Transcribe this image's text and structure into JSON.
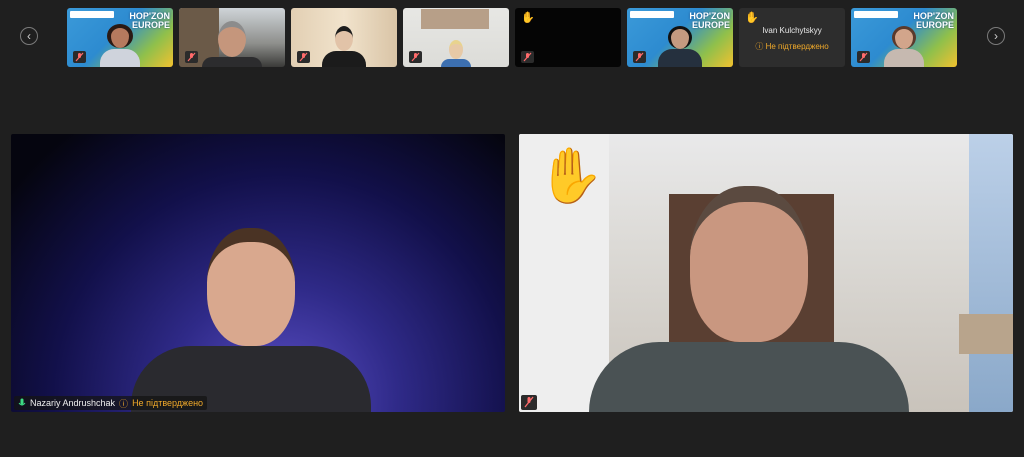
{
  "nav": {
    "prev_icon": "chevron-left-icon",
    "next_icon": "chevron-right-icon",
    "prev_glyph": "‹",
    "next_glyph": "›"
  },
  "thumbnails": [
    {
      "type": "banner",
      "banner_text": "HOP'ZON\nEUROPE",
      "muted": true
    },
    {
      "type": "video",
      "muted": true
    },
    {
      "type": "video",
      "muted": true
    },
    {
      "type": "video",
      "muted": true
    },
    {
      "type": "off",
      "hand_raised": true,
      "muted": true
    },
    {
      "type": "banner",
      "banner_text": "HOP'ZON\nEUROPE",
      "muted": true
    },
    {
      "type": "name-card",
      "hand_raised": true,
      "name": "Ivan Kulchytskyy",
      "status": "Не підтверджено"
    },
    {
      "type": "banner",
      "banner_text": "HOP'ZON\nEUROPE",
      "muted": true
    }
  ],
  "main_tiles": {
    "left": {
      "name": "Nazariy Andrushchak",
      "status": "Не підтверджено",
      "mic": "on"
    },
    "right": {
      "hand_raised": true,
      "muted": true
    }
  },
  "colors": {
    "background": "#1f1f1f",
    "warning": "#f0a92a",
    "tile_border": "#2a2a2a"
  },
  "icons": {
    "hand": "✋",
    "mic": "mic-icon",
    "muted_mic": "mic-off-icon",
    "warn": "question-circle-icon"
  }
}
